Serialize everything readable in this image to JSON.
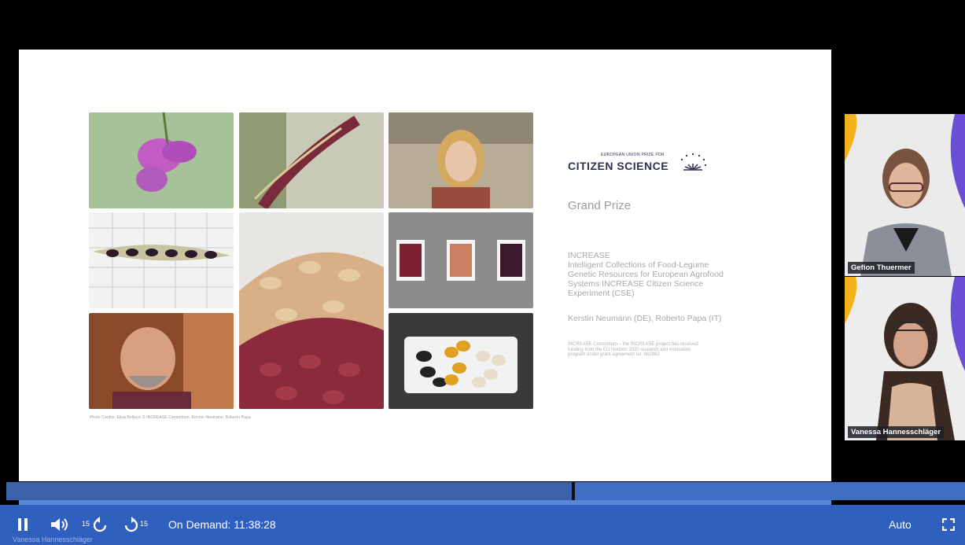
{
  "slide": {
    "photo_credit": "Photo Credits: Elisa Bellucci © INCREASE Consortium, Kerstin Neumann, Roberto Papa",
    "logo_small": "EUROPEAN UNION PRIZE FOR",
    "logo_big": "CITIZEN SCIENCE",
    "award": "Grand Prize",
    "project_lines": [
      "INCREASE",
      "Intelligent Collections of Food-Legume",
      "Genetic Resources for European Agrofood",
      "Systems INCREASE Citizen Science",
      "Experiment (CSE)"
    ],
    "authors": "Kerstin Neumann (DE), Roberto Papa (IT)",
    "funding_lines": [
      "INCREASE Consortium – the INCREASE project has received",
      "funding from the EU Horizon 2020 research and innovation",
      "program under grant agreement no. 862862"
    ]
  },
  "participants": [
    {
      "name": "Gefion Thuermer"
    },
    {
      "name": "Vanessa Hannesschläger"
    }
  ],
  "player": {
    "rewind_seconds": "15",
    "forward_seconds": "15",
    "status": "On Demand: 11:38:28",
    "quality": "Auto",
    "progress_fraction": 0.59,
    "watermark": "Vanessa Hannesschläger"
  }
}
